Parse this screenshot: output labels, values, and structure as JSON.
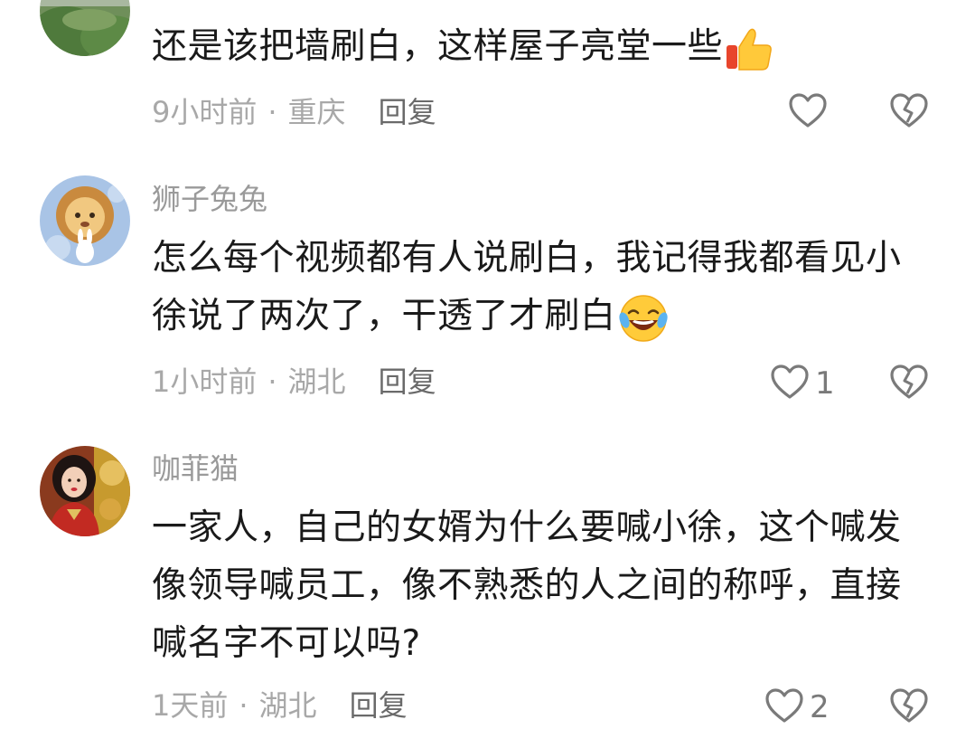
{
  "comments": [
    {
      "username": "",
      "lines": [
        "还是该把墙刷白，这样屋子亮堂一些"
      ],
      "emoji": "thumbs-up-emoji",
      "time": "9小时前",
      "location": "重庆",
      "reply_label": "回复",
      "likes": ""
    },
    {
      "username": "狮子兔兔",
      "lines": [
        "怎么每个视频都有人说刷白，我记得我都看见小",
        "徐说了两次了，干透了才刷白"
      ],
      "emoji": "laughing-crying-emoji",
      "time": "1小时前",
      "location": "湖北",
      "reply_label": "回复",
      "likes": "1"
    },
    {
      "username": "咖菲猫",
      "lines": [
        "一家人，自己的女婿为什么要喊小徐，这个喊发",
        "像领导喊员工，像不熟悉的人之间的称呼，直接",
        "喊名字不可以吗?"
      ],
      "emoji": "",
      "time": "1天前",
      "location": "湖北",
      "reply_label": "回复",
      "likes": "2"
    }
  ],
  "colors": {
    "text": "#1a1a1a",
    "meta": "#a8a8a8",
    "username": "#9a9a9a",
    "reply": "#6a6a6a",
    "icon": "#7a7a7a"
  }
}
